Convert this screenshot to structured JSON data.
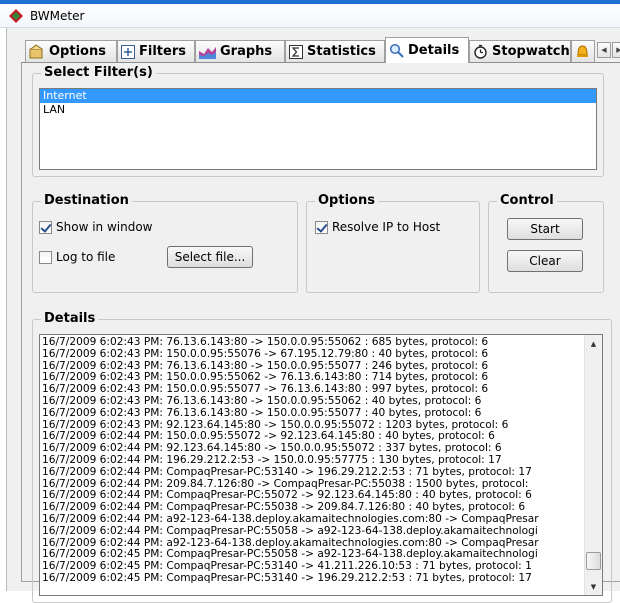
{
  "window": {
    "title": "BWMeter"
  },
  "tabs": [
    {
      "label": "Options",
      "icon": "options-icon"
    },
    {
      "label": "Filters",
      "icon": "filters-icon"
    },
    {
      "label": "Graphs",
      "icon": "graphs-icon"
    },
    {
      "label": "Statistics",
      "icon": "statistics-icon"
    },
    {
      "label": "Details",
      "icon": "search-icon",
      "active": true
    },
    {
      "label": "Stopwatch",
      "icon": "stopwatch-icon"
    },
    {
      "label": "",
      "icon": "alarm-bell-icon"
    }
  ],
  "filters": {
    "title": "Select Filter(s)",
    "items": [
      {
        "label": "Internet",
        "selected": true
      },
      {
        "label": "LAN",
        "selected": false
      }
    ]
  },
  "destination": {
    "title": "Destination",
    "show_in_window": "Show in window",
    "show_in_window_checked": true,
    "log_to_file": "Log to file",
    "log_to_file_checked": false,
    "select_file": "Select file..."
  },
  "options": {
    "title": "Options",
    "resolve_ip": "Resolve IP to Host",
    "resolve_ip_checked": true
  },
  "control": {
    "title": "Control",
    "start": "Start",
    "clear": "Clear"
  },
  "details": {
    "title": "Details",
    "lines": [
      "16/7/2009 6:02:43 PM: 76.13.6.143:80 -> 150.0.0.95:55062 : 685 bytes, protocol: 6",
      "16/7/2009 6:02:43 PM: 150.0.0.95:55076 -> 67.195.12.79:80 : 40 bytes, protocol: 6",
      "16/7/2009 6:02:43 PM: 76.13.6.143:80 -> 150.0.0.95:55077 : 246 bytes, protocol: 6",
      "16/7/2009 6:02:43 PM: 150.0.0.95:55062 -> 76.13.6.143:80 : 714 bytes, protocol: 6",
      "16/7/2009 6:02:43 PM: 150.0.0.95:55077 -> 76.13.6.143:80 : 997 bytes, protocol: 6",
      "16/7/2009 6:02:43 PM: 76.13.6.143:80 -> 150.0.0.95:55062 : 40 bytes, protocol: 6",
      "16/7/2009 6:02:43 PM: 76.13.6.143:80 -> 150.0.0.95:55077 : 40 bytes, protocol: 6",
      "16/7/2009 6:02:43 PM: 92.123.64.145:80 -> 150.0.0.95:55072 : 1203 bytes, protocol: 6",
      "16/7/2009 6:02:44 PM: 150.0.0.95:55072 -> 92.123.64.145:80 : 40 bytes, protocol: 6",
      "16/7/2009 6:02:44 PM: 92.123.64.145:80 -> 150.0.0.95:55072 : 337 bytes, protocol: 6",
      "16/7/2009 6:02:44 PM: 196.29.212.2:53 -> 150.0.0.95:57775 : 130 bytes, protocol: 17",
      "16/7/2009 6:02:44 PM: CompaqPresar-PC:53140 -> 196.29.212.2:53 : 71 bytes, protocol: 17",
      "16/7/2009 6:02:44 PM: 209.84.7.126:80 -> CompaqPresar-PC:55038 : 1500 bytes, protocol:",
      "16/7/2009 6:02:44 PM: CompaqPresar-PC:55072 -> 92.123.64.145:80 : 40 bytes, protocol: 6",
      "16/7/2009 6:02:44 PM: CompaqPresar-PC:55038 -> 209.84.7.126:80 : 40 bytes, protocol: 6",
      "16/7/2009 6:02:44 PM: a92-123-64-138.deploy.akamaitechnologies.com:80 -> CompaqPresar",
      "16/7/2009 6:02:44 PM: CompaqPresar-PC:55058 -> a92-123-64-138.deploy.akamaitechnologi",
      "16/7/2009 6:02:44 PM: a92-123-64-138.deploy.akamaitechnologies.com:80 -> CompaqPresar",
      "16/7/2009 6:02:45 PM: CompaqPresar-PC:55058 -> a92-123-64-138.deploy.akamaitechnologi",
      "16/7/2009 6:02:45 PM: CompaqPresar-PC:53140 -> 41.211.226.10:53 : 71 bytes, protocol: 1",
      "16/7/2009 6:02:45 PM: CompaqPresar-PC:53140 -> 196.29.212.2:53 : 71 bytes, protocol: 17"
    ]
  },
  "colors": {
    "selection": "#3399ff",
    "accent_bar": "#1f6fd4"
  }
}
